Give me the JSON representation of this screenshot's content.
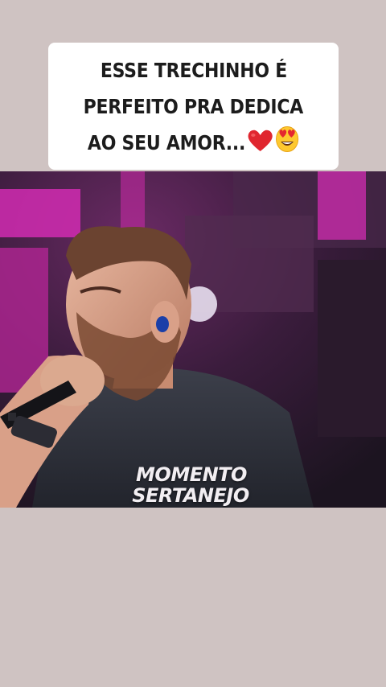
{
  "caption": {
    "line1": "ESSE TRECHINHO É",
    "line2": "PERFEITO PRA DEDICA",
    "line3": "AO SEU AMOR...",
    "emojis": [
      "red-heart-icon",
      "heart-eyes-face-icon"
    ]
  },
  "video": {
    "watermark_line1": "MOMENTO",
    "watermark_line2": "SERTANEJO"
  },
  "colors": {
    "background": "#cfc3c2",
    "caption_bg": "#ffffff",
    "stage_pink": "#d02bb0"
  }
}
